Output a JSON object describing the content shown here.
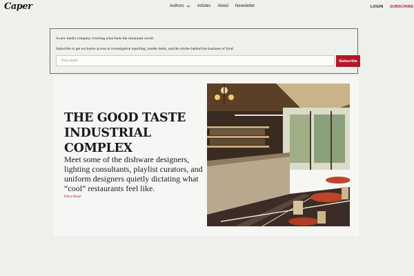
{
  "header": {
    "logo": "Caper",
    "nav": [
      {
        "label": "Authors",
        "has_dropdown": true
      },
      {
        "label": "Articles"
      },
      {
        "label": "About"
      },
      {
        "label": "Newsletter"
      }
    ],
    "login": "LOGIN",
    "subscribe": "SUBSCRIBE"
  },
  "signup": {
    "tagline": "A new media company covering what fuels the restaurant world.",
    "description": "Subscribe to get exclusive access to investigative reporting, insider deals, and the stories behind the business of food.",
    "email_placeholder": "Your email",
    "button_label": "Subscribe"
  },
  "feature": {
    "headline": "THE GOOD TASTE INDUSTRIAL COMPLEX",
    "dek": "Meet some of the dishware designers, lighting consultants, playlist curators, and uniform designers quietly dictating what “cool” restaurants feel like.",
    "author": "Dalya Rasor"
  },
  "colors": {
    "accent": "#b3182a",
    "background": "#eef0ec",
    "card": "#f6f7f4"
  }
}
